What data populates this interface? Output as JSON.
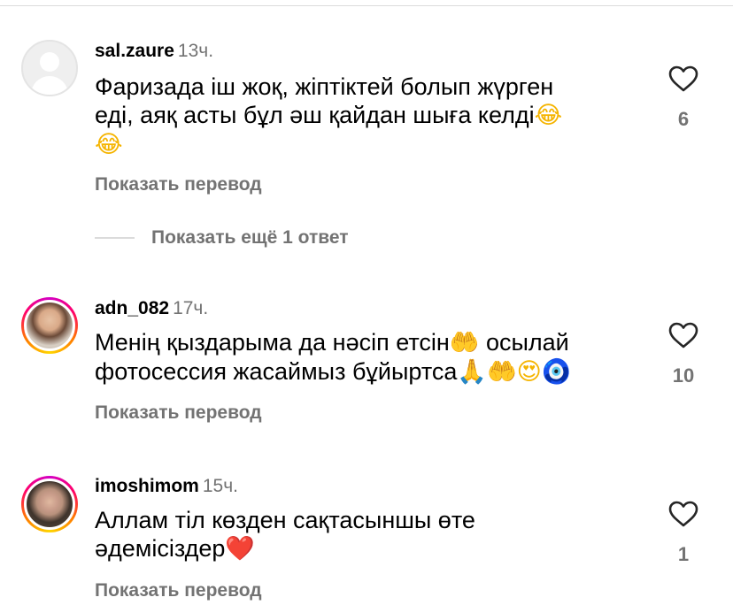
{
  "comments": [
    {
      "username": "sal.zaure",
      "time": "13ч.",
      "text_line1": "Фаризада іш жоқ, жіптіктей болып жүрген",
      "text_line2": "еді, аяқ асты бұл әш қайдан шыға келді",
      "text_line3": "",
      "emoji_end_line2": "😂",
      "emoji_line3": "😂",
      "likes": "6",
      "translate_label": "Показать перевод",
      "avatar": "default-avatar"
    },
    {
      "username": "adn_082",
      "time": "17ч.",
      "text_line1": "Менің қыздарыма да нәсіп етсін",
      "text_line1_tail": " осылай",
      "text_line2": "фотосессия жасаймыз бұйыртса",
      "emoji_line1": "🤲",
      "emoji_line2": [
        "🙏",
        "🤲",
        "😍",
        "🧿"
      ],
      "likes": "10",
      "translate_label": "Показать перевод",
      "avatar": "photo"
    },
    {
      "username": "imoshimom",
      "time": "15ч.",
      "text_line1": "Аллам тіл көзден сақтасыншы өте",
      "text_line2": "әдемісіздер",
      "emoji_line2": "❤️",
      "likes": "1",
      "translate_label": "Показать перевод",
      "avatar": "photo"
    }
  ],
  "replies_label": "Показать ещё 1 ответ",
  "colors": {
    "text": "#000000",
    "secondary": "#737373",
    "divider": "#dbdbdb",
    "heart_emoji": "#e0202e"
  },
  "icons": {
    "like": "heart-outline-icon",
    "default_avatar": "user-silhouette-icon"
  }
}
